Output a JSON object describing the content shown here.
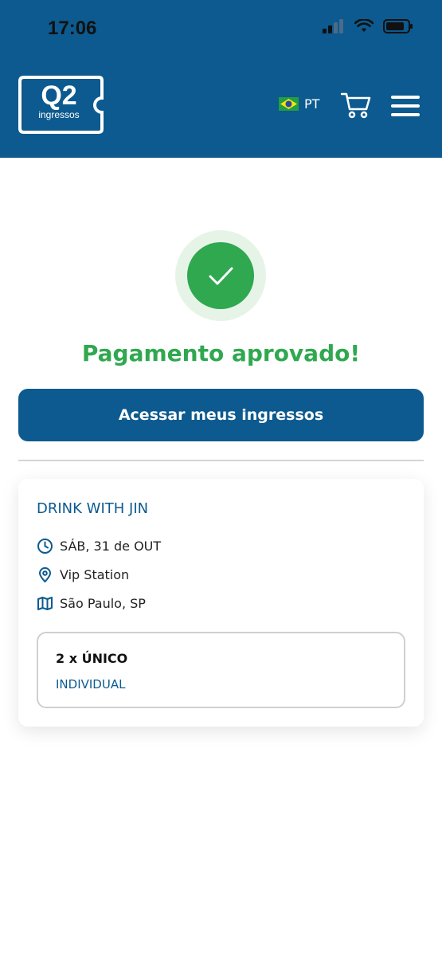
{
  "status_bar": {
    "time": "17:06"
  },
  "header": {
    "logo_main": "Q2",
    "logo_sub": "ingressos",
    "language": "PT",
    "icons": {
      "flag": "brazil-flag-icon",
      "cart": "cart-icon",
      "menu": "hamburger-menu-icon"
    }
  },
  "success": {
    "icon": "check-icon",
    "message": "Pagamento aprovado!"
  },
  "actions": {
    "primary_label": "Acessar meus ingressos"
  },
  "event": {
    "title": "DRINK WITH JIN",
    "date": "SÁB, 31 de OUT",
    "venue": "Vip Station",
    "city": "São Paulo, SP",
    "ticket": {
      "quantity_label": "2 x ÚNICO",
      "type_label": "INDIVIDUAL"
    }
  },
  "colors": {
    "brand": "#0c5a8f",
    "success": "#2fa84f"
  }
}
